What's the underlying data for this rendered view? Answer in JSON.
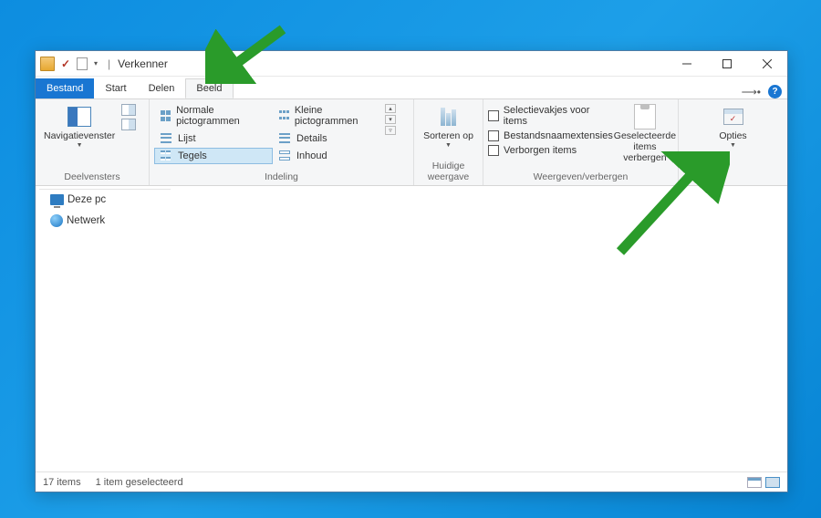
{
  "title": "Verkenner",
  "tabs": {
    "file": "Bestand",
    "start": "Start",
    "delen": "Delen",
    "beeld": "Beeld"
  },
  "ribbon": {
    "panes": {
      "navigatievenster": "Navigatievenster",
      "group_label": "Deelvensters"
    },
    "layout": {
      "normal": "Normale pictogrammen",
      "kleine": "Kleine pictogrammen",
      "lijst": "Lijst",
      "details": "Details",
      "tegels": "Tegels",
      "inhoud": "Inhoud",
      "group_label": "Indeling"
    },
    "current_view": {
      "sorteren": "Sorteren op",
      "group_label": "Huidige weergave"
    },
    "show_hide": {
      "selectievakjes": "Selectievakjes voor items",
      "extensies": "Bestandsnaamextensies",
      "verborgen": "Verborgen items",
      "hide_selected_l1": "Geselecteerde",
      "hide_selected_l2": "items verbergen",
      "group_label": "Weergeven/verbergen"
    },
    "options": {
      "label": "Opties"
    }
  },
  "nav": {
    "thispc": "Deze pc",
    "network": "Netwerk"
  },
  "status": {
    "items": "17 items",
    "selected": "1 item geselecteerd"
  }
}
